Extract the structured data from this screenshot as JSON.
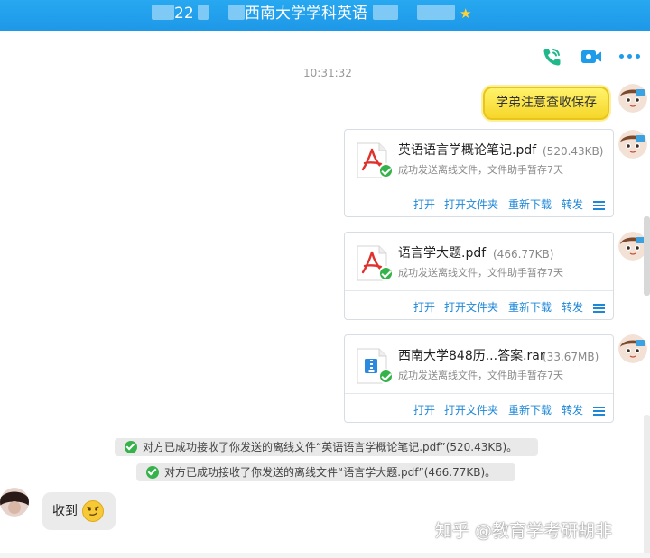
{
  "titlebar": {
    "number_fragment": "22",
    "group_name": "西南大学学科英语",
    "star_icon": "star-icon"
  },
  "toolbar": {
    "icons": [
      "phone-call-icon",
      "video-call-icon",
      "more-options-icon"
    ],
    "accent": "#1f9ce9"
  },
  "timestamp": "10:31:32",
  "messages": {
    "yellow_text": "学弟注意查收保存",
    "files": [
      {
        "name": "英语语言学概论笔记.pdf",
        "size": "(520.43KB)",
        "type": "pdf",
        "status": "成功发送离线文件，文件助手暂存7天",
        "actions": [
          "打开",
          "打开文件夹",
          "重新下载",
          "转发"
        ]
      },
      {
        "name": "语言学大题.pdf",
        "size": "(466.77KB)",
        "type": "pdf",
        "status": "成功发送离线文件，文件助手暂存7天",
        "actions": [
          "打开",
          "打开文件夹",
          "重新下载",
          "转发"
        ]
      },
      {
        "name": "西南大学848历...答案.rar",
        "size": "(33.67MB)",
        "type": "rar",
        "status": "成功发送离线文件，文件助手暂存7天",
        "actions": [
          "打开",
          "打开文件夹",
          "重新下载",
          "转发"
        ]
      }
    ],
    "notices": [
      "对方已成功接收了你发送的离线文件“英语语言学概论笔记.pdf”(520.43KB)。",
      "对方已成功接收了你发送的离线文件“语言学大题.pdf”(466.77KB)。"
    ],
    "reply": {
      "text": "收到",
      "emoji": "smirk-emoji-icon"
    }
  },
  "watermark": "知乎 @教育学考研胡非",
  "colors": {
    "titlebar": "#1e98e8",
    "link": "#1e88d8",
    "success": "#35b24a",
    "yellow_bubble": "#f6d62a"
  }
}
